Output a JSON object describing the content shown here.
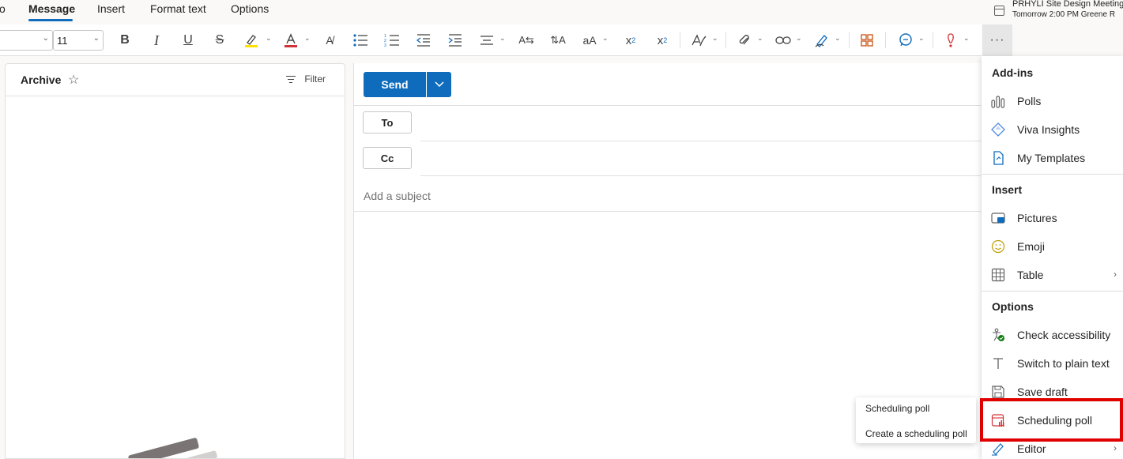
{
  "tabs": [
    {
      "label": "o"
    },
    {
      "label": "Message"
    },
    {
      "label": "Insert"
    },
    {
      "label": "Format text"
    },
    {
      "label": "Options"
    }
  ],
  "meeting": {
    "title": "PRHYLI Site Design Meeting",
    "time": "Tomorrow 2:00 PM  Greene R"
  },
  "ribbon": {
    "font_size": "11",
    "aa_label": "aA",
    "more_label": "···"
  },
  "left_panel": {
    "title": "Archive",
    "filter_label": "Filter"
  },
  "compose": {
    "send_label": "Send",
    "to_label": "To",
    "cc_label": "Cc",
    "subject_placeholder": "Add a subject"
  },
  "menu": {
    "sections": [
      {
        "heading": "Add-ins",
        "items": [
          "Polls",
          "Viva Insights",
          "My Templates"
        ]
      },
      {
        "heading": "Insert",
        "items": [
          "Pictures",
          "Emoji",
          "Table"
        ]
      },
      {
        "heading": "Options",
        "items": [
          "Check accessibility",
          "Switch to plain text",
          "Save draft",
          "Scheduling poll",
          "Editor"
        ]
      }
    ]
  },
  "flyout": {
    "items": [
      "Scheduling poll",
      "Create a scheduling poll"
    ]
  },
  "colors": {
    "accent": "#0f6cbd",
    "highlight_box": "#e00000",
    "highlighter_yellow": "#ffe100",
    "font_color_red": "#d13438"
  }
}
